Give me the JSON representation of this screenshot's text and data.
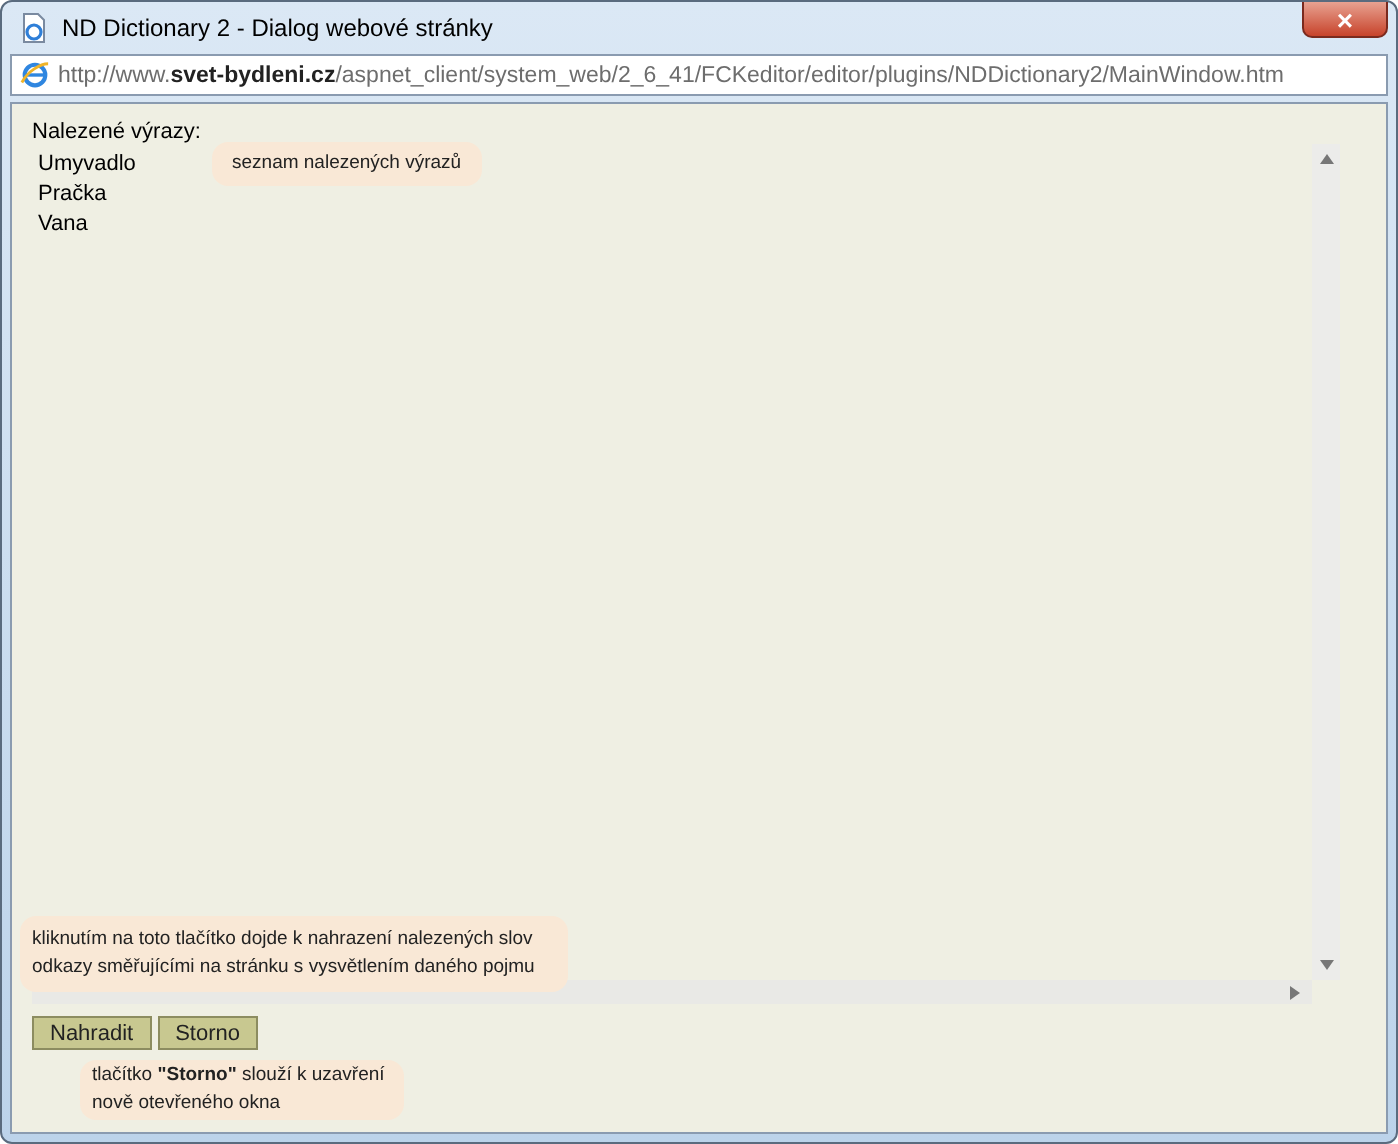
{
  "window": {
    "title": "ND Dictionary 2 - Dialog webové stránky",
    "close": "×"
  },
  "address": "http://www.**svet-bydleni.cz**/aspnet_client/system_web/2_6_41/FCKeditor/editor/plugins/NDDictionary2/MainWindow.htm",
  "list": {
    "label": "Nalezené výrazy:",
    "items": [
      "Umyvadlo",
      "Pračka",
      "Vana"
    ]
  },
  "buttons": [
    "Nahradit",
    "Storno"
  ],
  "callouts": [
    {
      "kind": "list",
      "text": "seznam nalezených výrazů"
    },
    {
      "kind": "replace",
      "text": "kliknutím na toto tlačítko dojde k nahrazení nalezených slov odkazy směřujícími na stránku s vysvětlením daného pojmu"
    },
    {
      "kind": "cancel",
      "text": "tlačítko **\"Storno\"** slouží k uzavření nově otevřeného okna"
    }
  ]
}
